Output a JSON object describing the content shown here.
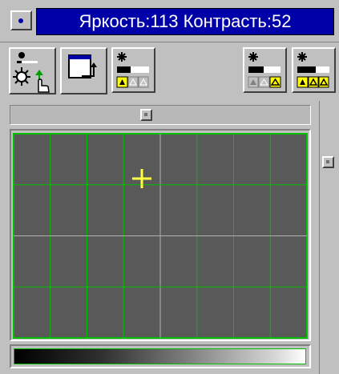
{
  "window": {
    "title": "Яркость:113 Контрасть:52"
  },
  "toolbar": {
    "buttons": [
      {
        "icon": "brightness-pointer-icon"
      },
      {
        "icon": "window-arrow-icon"
      },
      {
        "icon": "brightness-preset-icon"
      },
      {
        "icon": "brightness-preset-icon"
      },
      {
        "icon": "brightness-preset-icon"
      }
    ]
  },
  "colors": {
    "title_bg": "#0000a8",
    "panel_bg": "#c0c0c0",
    "grid_bg": "#595959",
    "grid_line": "#00c000",
    "center_line": "#b0b0b0",
    "cursor": "#ffff40"
  },
  "curve": {
    "brightness": 113,
    "contrast": 52,
    "grid_columns": 8,
    "grid_rows": 4
  }
}
